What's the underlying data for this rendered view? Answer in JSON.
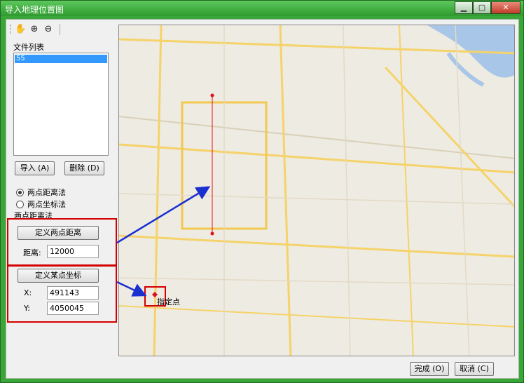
{
  "window": {
    "title": "导入地理位置图"
  },
  "toolbar": {
    "tools": [
      "hand-icon",
      "zoom-in-icon",
      "zoom-out-icon"
    ]
  },
  "file_list": {
    "label": "文件列表",
    "items": [
      "55"
    ]
  },
  "buttons": {
    "import": "导入 (A)",
    "delete": "删除 (D)",
    "define_distance": "定义两点距离",
    "define_coord": "定义某点坐标",
    "finish": "完成 (O)",
    "cancel": "取消 (C)"
  },
  "methods": {
    "two_point_distance": "两点距离法",
    "two_point_coord": "两点坐标法",
    "current": "两点距离法"
  },
  "distance": {
    "label": "距离:",
    "value": "12000"
  },
  "coord": {
    "x_label": "X:",
    "x_value": "491143",
    "y_label": "Y:",
    "y_value": "4050045"
  },
  "map": {
    "point_label": "指定点"
  },
  "colors": {
    "titlebar": "#3aa63a",
    "highlight": "#d40000",
    "arrow": "#1a2fd0",
    "line": "#e0101a"
  }
}
